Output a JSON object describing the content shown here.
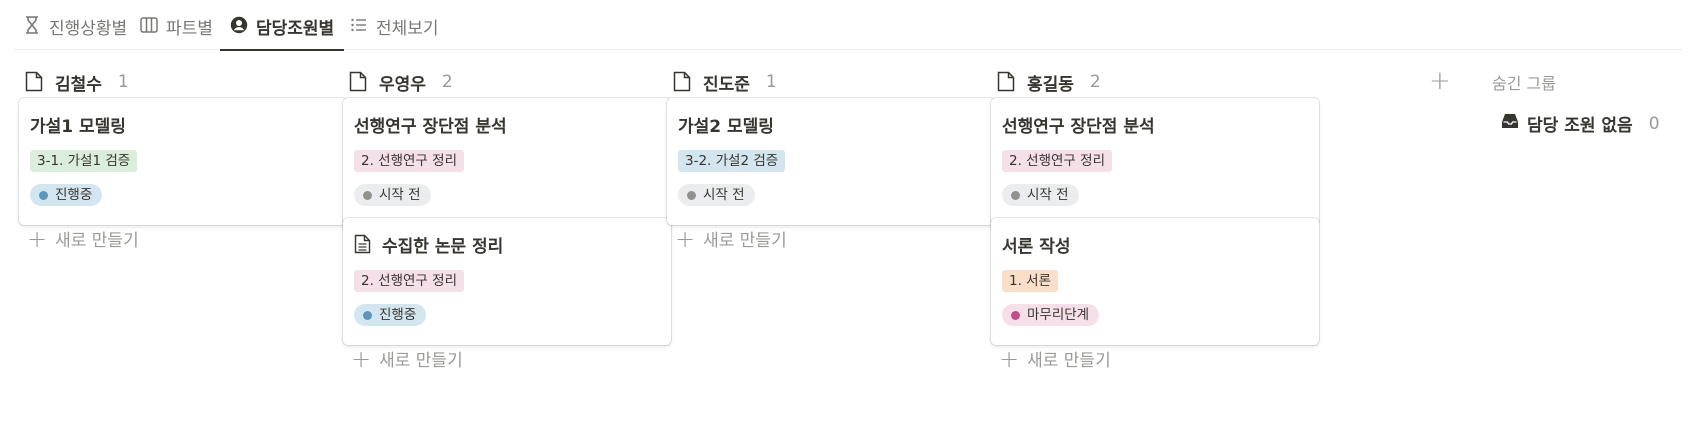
{
  "tabs": [
    {
      "label": "진행상황별",
      "icon": "hourglass-icon",
      "active": false
    },
    {
      "label": "파트별",
      "icon": "columns-icon",
      "active": false
    },
    {
      "label": "담당조원별",
      "icon": "user-circle-icon",
      "active": true
    },
    {
      "label": "전체보기",
      "icon": "list-icon",
      "active": false
    }
  ],
  "columns": [
    {
      "title": "김철수",
      "count": "1",
      "cards": [
        {
          "title": "가설1 모델링",
          "tag": "3-1. 가설1 검증",
          "status": "진행중"
        }
      ]
    },
    {
      "title": "우영우",
      "count": "2",
      "cards": [
        {
          "title": "선행연구 장단점 분석",
          "tag": "2. 선행연구 정리",
          "status": "시작 전"
        },
        {
          "title": "수집한 논문 정리",
          "tag": "2. 선행연구 정리",
          "status": "진행중"
        }
      ]
    },
    {
      "title": "진도준",
      "count": "1",
      "cards": [
        {
          "title": "가설2 모델링",
          "tag": "3-2. 가설2 검증",
          "status": "시작 전"
        }
      ]
    },
    {
      "title": "홍길동",
      "count": "2",
      "cards": [
        {
          "title": "선행연구 장단점 분석",
          "tag": "2. 선행연구 정리",
          "status": "시작 전"
        },
        {
          "title": "서론 작성",
          "tag": "1. 서론",
          "status": "마무리단계"
        }
      ]
    }
  ],
  "new_label": "새로 만들기",
  "add_group": "+",
  "hidden_groups": {
    "label": "숨긴 그룹",
    "item_label": "담당 조원 없음",
    "item_count": "0"
  },
  "colors": {
    "tag_green": "#dbeddb",
    "tag_pink": "#f5e0e9",
    "tag_blue": "#d3e5ef",
    "tag_orange": "#fadec9",
    "status_blue_bg": "#d3e5ef",
    "status_blue_dot": "#5b97bd",
    "status_gray_bg": "#ebeced",
    "status_gray_dot": "#91918e",
    "status_pink_bg": "#f5e0e9",
    "status_pink_dot": "#c14c8a"
  }
}
